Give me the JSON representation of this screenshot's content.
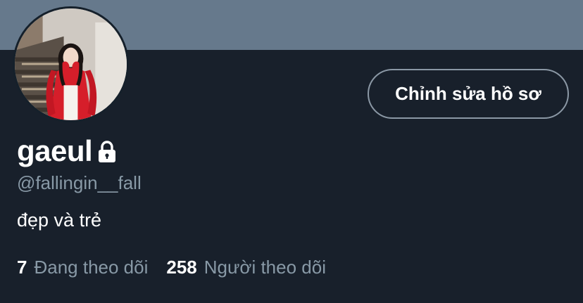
{
  "profile": {
    "display_name": "gaeul",
    "handle": "@fallingin__fall",
    "bio": "đẹp và trẻ",
    "protected_icon": "lock-icon",
    "edit_button_label": "Chỉnh sửa hồ sơ",
    "stats": {
      "following_count": "7",
      "following_label": "Đang theo dõi",
      "followers_count": "258",
      "followers_label": "Người theo dõi"
    }
  },
  "colors": {
    "banner": "#66798c",
    "background": "#18202b",
    "secondary_text": "#8899a6",
    "button_border": "#8b98a5"
  }
}
